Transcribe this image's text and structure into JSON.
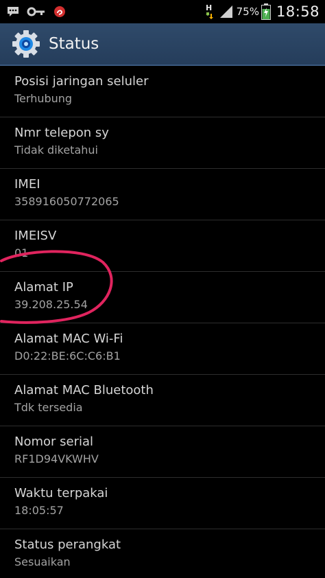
{
  "status_bar": {
    "battery_percent": "75%",
    "time": "18:58",
    "network_type": "H",
    "icons": [
      "chat-icon",
      "key-icon",
      "app-notification-icon",
      "data-arrows-icon",
      "signal-icon",
      "battery-charging-icon"
    ]
  },
  "action_bar": {
    "title": "Status",
    "icon": "settings-gear-icon"
  },
  "items": [
    {
      "label": "Posisi jaringan seluler",
      "value": "Terhubung"
    },
    {
      "label": "Nmr telepon sy",
      "value": "Tidak diketahui"
    },
    {
      "label": "IMEI",
      "value": "358916050772065"
    },
    {
      "label": "IMEISV",
      "value": "01"
    },
    {
      "label": "Alamat IP",
      "value": "39.208.25.54"
    },
    {
      "label": "Alamat MAC Wi-Fi",
      "value": "D0:22:BE:6C:C6:B1"
    },
    {
      "label": "Alamat MAC Bluetooth",
      "value": "Tdk tersedia"
    },
    {
      "label": "Nomor serial",
      "value": "RF1D94VKWHV"
    },
    {
      "label": "Waktu terpakai",
      "value": "18:05:57"
    },
    {
      "label": "Status perangkat",
      "value": "Sesuaikan"
    }
  ],
  "colors": {
    "action_bar": "#2f4a6a",
    "annotation": "#e0245e",
    "battery_charging": "#4caf50"
  }
}
